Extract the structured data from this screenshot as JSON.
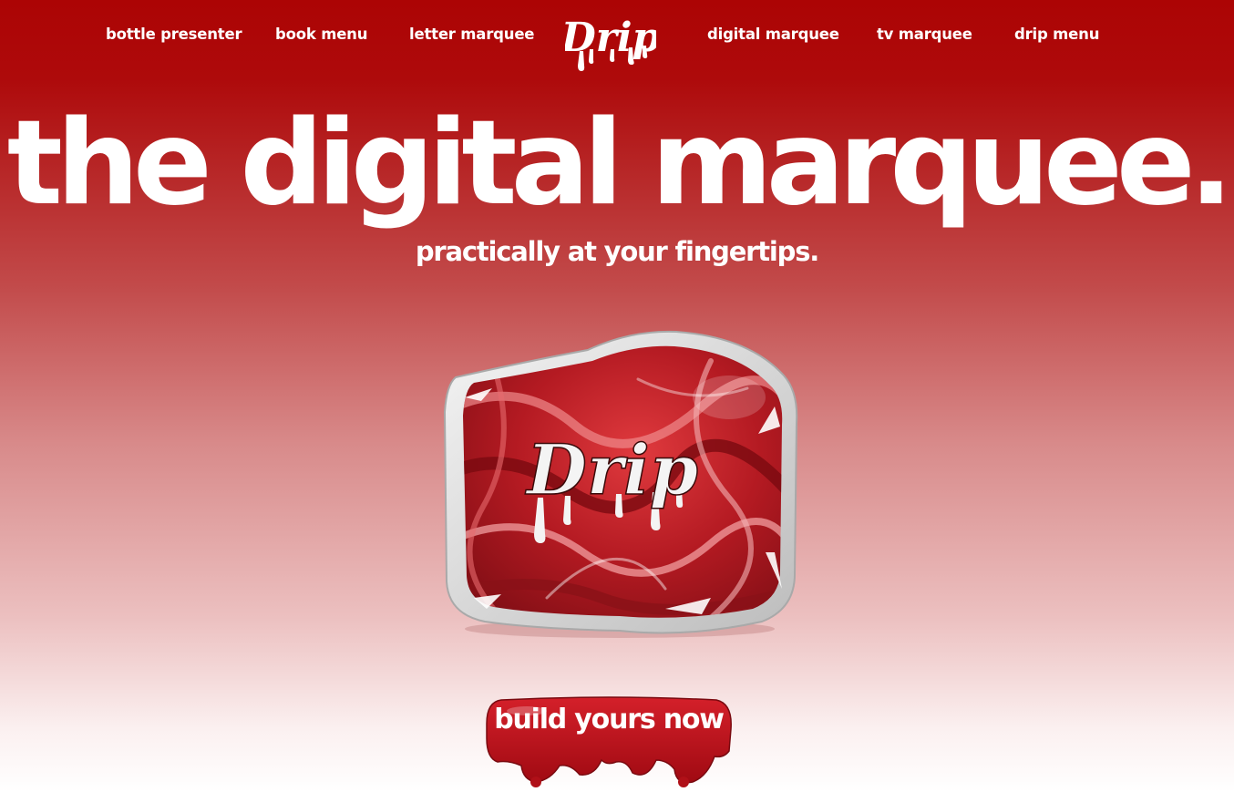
{
  "nav": {
    "links": [
      {
        "label": "bottle presenter"
      },
      {
        "label": "book menu"
      },
      {
        "label": "letter marquee"
      },
      {
        "label": "digital marquee"
      },
      {
        "label": "tv marquee"
      },
      {
        "label": "drip menu"
      }
    ],
    "logo": {
      "text": "Drip",
      "icon": "drip-logo-icon"
    }
  },
  "hero": {
    "title": "the digital marquee.",
    "subtitle": "practically at your fingertips."
  },
  "product": {
    "logo_text": "Drip",
    "icon": "digital-marquee-sign-image"
  },
  "cta": {
    "label": "build yours now",
    "icon": "drip-blob-icon"
  },
  "colors": {
    "brand_red": "#ac0404",
    "marble_red": "#b41a22",
    "white": "#ffffff"
  }
}
